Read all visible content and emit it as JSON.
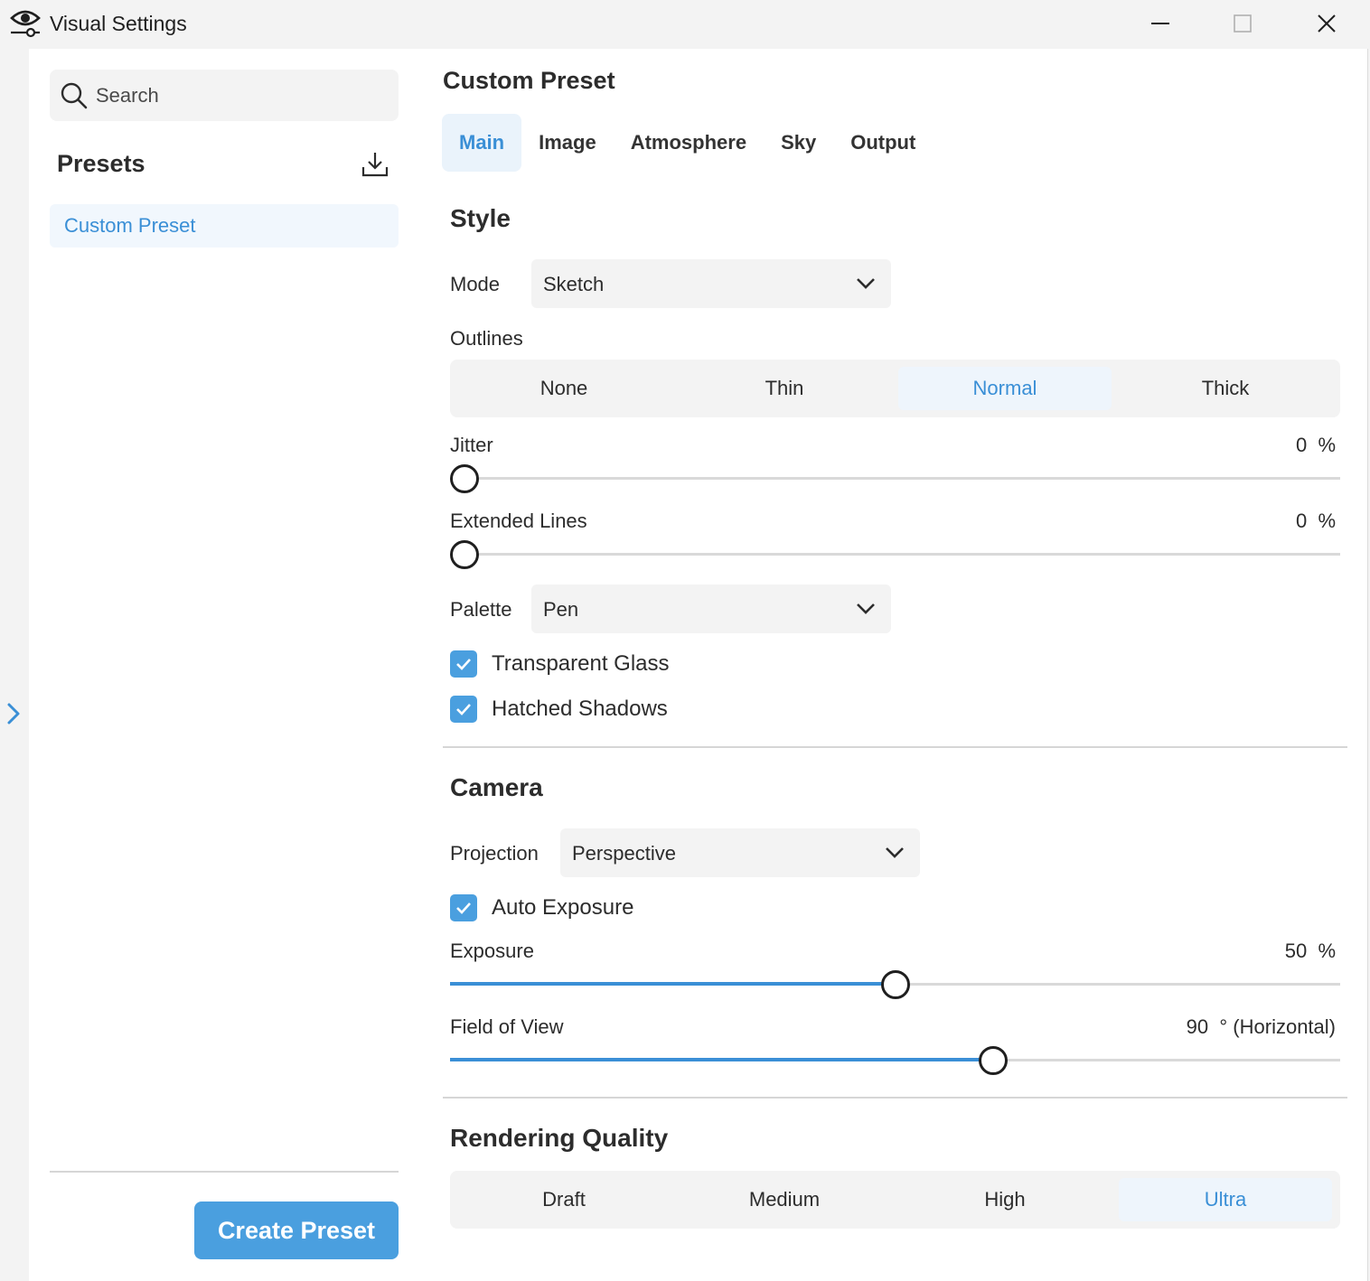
{
  "window": {
    "title": "Visual Settings",
    "icon": "eye-settings-icon"
  },
  "sidebar": {
    "search_placeholder": "Search",
    "presets_title": "Presets",
    "preset_items": [
      "Custom Preset"
    ],
    "create_button": "Create Preset"
  },
  "main": {
    "title": "Custom Preset",
    "tabs": [
      "Main",
      "Image",
      "Atmosphere",
      "Sky",
      "Output"
    ],
    "active_tab": "Main",
    "style": {
      "title": "Style",
      "mode_label": "Mode",
      "mode_value": "Sketch",
      "outlines_label": "Outlines",
      "outlines_options": [
        "None",
        "Thin",
        "Normal",
        "Thick"
      ],
      "outlines_selected": "Normal",
      "jitter_label": "Jitter",
      "jitter_value": "0",
      "jitter_unit": "%",
      "jitter_percent": 0,
      "extended_label": "Extended Lines",
      "extended_value": "0",
      "extended_unit": "%",
      "extended_percent": 0,
      "palette_label": "Palette",
      "palette_value": "Pen",
      "transparent_glass": "Transparent Glass",
      "transparent_glass_checked": true,
      "hatched_shadows": "Hatched Shadows",
      "hatched_shadows_checked": true
    },
    "camera": {
      "title": "Camera",
      "projection_label": "Projection",
      "projection_value": "Perspective",
      "auto_exposure": "Auto Exposure",
      "auto_exposure_checked": true,
      "exposure_label": "Exposure",
      "exposure_value": "50",
      "exposure_unit": "%",
      "exposure_percent": 50,
      "fov_label": "Field of View",
      "fov_value": "90",
      "fov_unit": "° (Horizontal)",
      "fov_percent": 61
    },
    "rendering": {
      "title": "Rendering Quality",
      "options": [
        "Draft",
        "Medium",
        "High",
        "Ultra"
      ],
      "selected": "Ultra"
    }
  },
  "colors": {
    "accent": "#3a8fd6",
    "button": "#4a9fdf",
    "selected_bg": "#eef5fc"
  }
}
